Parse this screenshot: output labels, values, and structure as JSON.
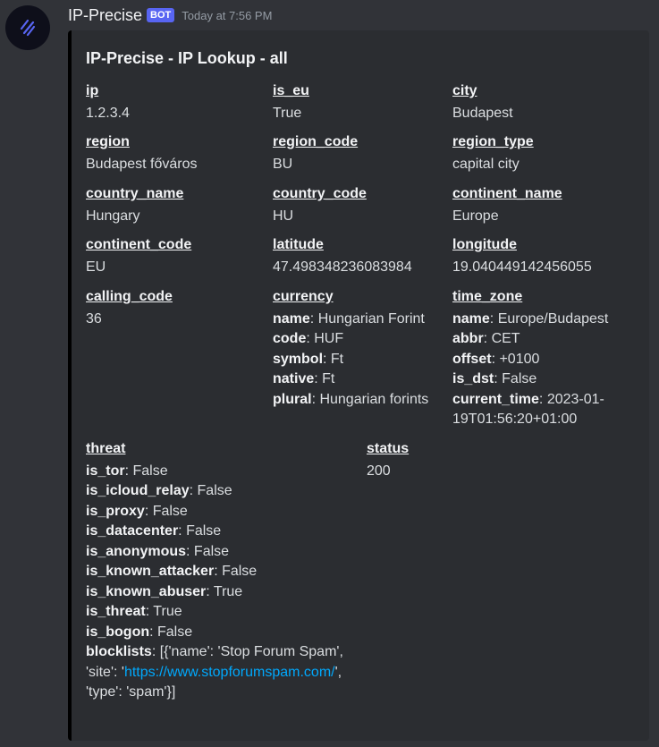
{
  "message": {
    "username": "IP-Precise",
    "bot_tag": "BOT",
    "timestamp": "Today at 7:56 PM"
  },
  "colors": {
    "embed_border": "#000000",
    "bot_tag": "#5865f2",
    "link": "#00a8fc",
    "avatar_icon": "#5865f2"
  },
  "embed": {
    "title": "IP-Precise - IP Lookup - all",
    "fields": {
      "ip": {
        "name": "ip",
        "value": "1.2.3.4"
      },
      "is_eu": {
        "name": "is_eu",
        "value": "True"
      },
      "city": {
        "name": "city",
        "value": "Budapest"
      },
      "region": {
        "name": "region",
        "value": "Budapest főváros"
      },
      "region_code": {
        "name": "region_code",
        "value": "BU"
      },
      "region_type": {
        "name": "region_type",
        "value": "capital city"
      },
      "country_name": {
        "name": "country_name",
        "value": "Hungary"
      },
      "country_code": {
        "name": "country_code",
        "value": "HU"
      },
      "continent_name": {
        "name": "continent_name",
        "value": "Europe"
      },
      "continent_code": {
        "name": "continent_code",
        "value": "EU"
      },
      "latitude": {
        "name": "latitude",
        "value": "47.498348236083984"
      },
      "longitude": {
        "name": "longitude",
        "value": "19.040449142456055"
      },
      "calling_code": {
        "name": "calling_code",
        "value": "36"
      },
      "currency": {
        "name": "currency",
        "items": [
          {
            "key": "name",
            "value": ": Hungarian Forint"
          },
          {
            "key": "code",
            "value": ": HUF"
          },
          {
            "key": "symbol",
            "value": ": Ft"
          },
          {
            "key": "native",
            "value": ": Ft"
          },
          {
            "key": "plural",
            "value": ": Hungarian forints"
          }
        ]
      },
      "time_zone": {
        "name": "time_zone",
        "items": [
          {
            "key": "name",
            "value": ": Europe/Budapest"
          },
          {
            "key": "abbr",
            "value": ": CET"
          },
          {
            "key": "offset",
            "value": ": +0100"
          },
          {
            "key": "is_dst",
            "value": ": False"
          },
          {
            "key": "current_time",
            "value": ": 2023-01-19T01:56:20+01:00"
          }
        ]
      },
      "threat": {
        "name": "threat",
        "items": [
          {
            "key": "is_tor",
            "value": ": False"
          },
          {
            "key": "is_icloud_relay",
            "value": ": False"
          },
          {
            "key": "is_proxy",
            "value": ": False"
          },
          {
            "key": "is_datacenter",
            "value": ": False"
          },
          {
            "key": "is_anonymous",
            "value": ": False"
          },
          {
            "key": "is_known_attacker",
            "value": ": False"
          },
          {
            "key": "is_known_abuser",
            "value": ": True"
          },
          {
            "key": "is_threat",
            "value": ": True"
          },
          {
            "key": "is_bogon",
            "value": ": False"
          }
        ],
        "blocklists": {
          "key": "blocklists",
          "before": ": [{'name': 'Stop Forum Spam', 'site': '",
          "link": "https://www.stopforumspam.com/",
          "after": "', 'type': 'spam'}]"
        }
      },
      "status": {
        "name": "status",
        "value": "200"
      }
    }
  }
}
